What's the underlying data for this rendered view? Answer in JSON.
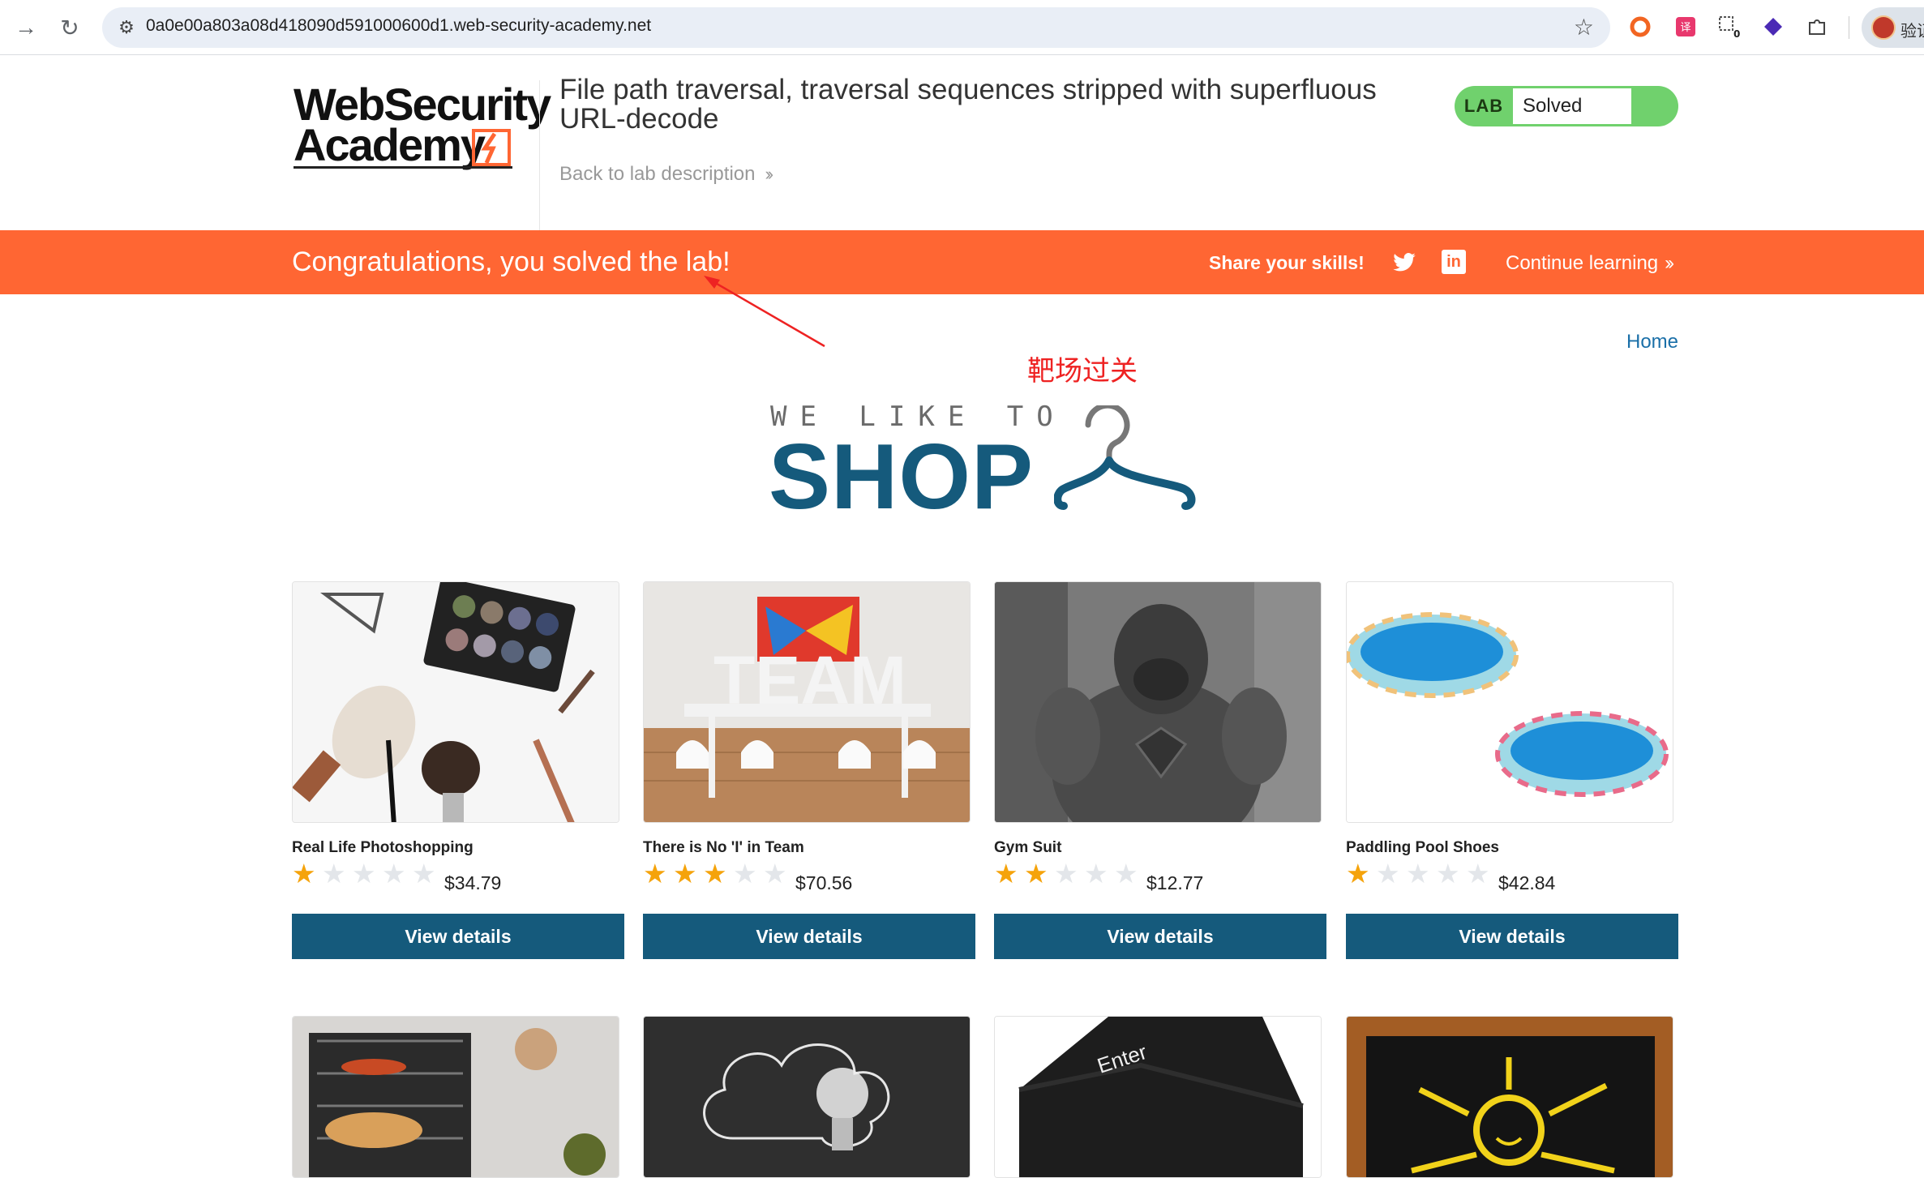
{
  "browser": {
    "url": "0a0e00a803a08d418090d591000600d1.web-security-academy.net",
    "profile_label": "验证"
  },
  "header": {
    "logo_line1": "WebSecurity",
    "logo_line2": "Academy",
    "lab_title": "File path traversal, traversal sequences stripped with superfluous URL-decode",
    "back_link": "Back to lab description",
    "lab_tag": "LAB",
    "lab_status": "Solved"
  },
  "banner": {
    "congrats": "Congratulations, you solved the lab!",
    "share": "Share your skills!",
    "continue": "Continue learning"
  },
  "nav": {
    "home": "Home"
  },
  "annotation": {
    "text": "靶场过关"
  },
  "shop_logo": {
    "tagline": "WE LIKE TO",
    "word": "SHOP"
  },
  "products": [
    {
      "name": "Real Life Photoshopping",
      "rating": 1,
      "price": "$34.79",
      "button": "View details"
    },
    {
      "name": "There is No 'I' in Team",
      "rating": 3,
      "price": "$70.56",
      "button": "View details"
    },
    {
      "name": "Gym Suit",
      "rating": 2,
      "price": "$12.77",
      "button": "View details"
    },
    {
      "name": "Paddling Pool Shoes",
      "rating": 1,
      "price": "$42.84",
      "button": "View details"
    }
  ],
  "colors": {
    "banner": "#ff6633",
    "primary": "#155a7c",
    "lab_solved": "#70d16d",
    "star_on": "#f5a30b",
    "annotation": "#ee2222"
  }
}
